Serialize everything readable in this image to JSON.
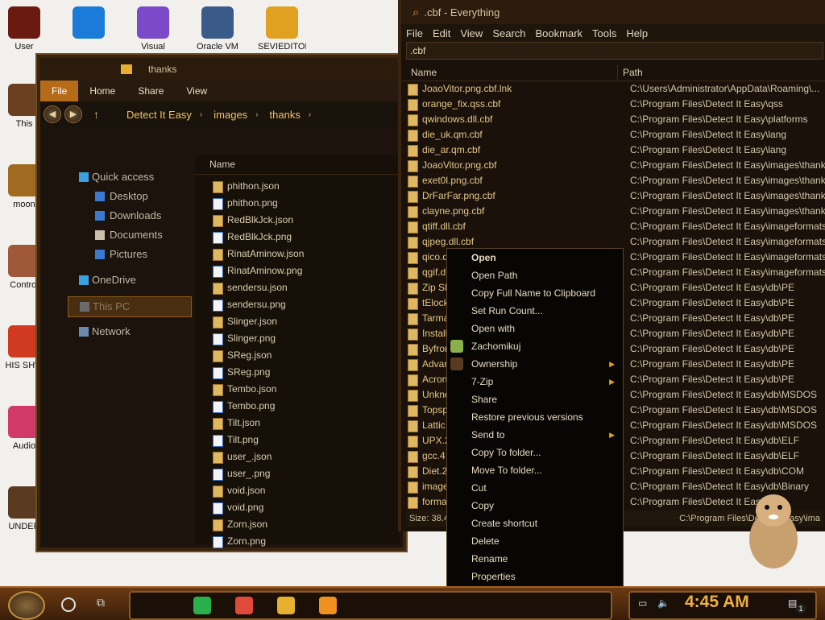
{
  "desktop": {
    "icons": [
      {
        "label": "User",
        "color": "#6a1a10"
      },
      {
        "label": "",
        "color": "#1a7cd8"
      },
      {
        "label": "Visual",
        "color": "#7a4ac8"
      },
      {
        "label": "Oracle VM",
        "color": "#3a5a8a"
      },
      {
        "label": "SEVIEDITOR",
        "color": "#e0a020"
      },
      {
        "label": "This",
        "color": "#6a4020"
      },
      {
        "label": "moon",
        "color": "#a06a20"
      },
      {
        "label": "Control",
        "color": "#a0583a"
      },
      {
        "label": "HIS SHW",
        "color": "#d03a20"
      },
      {
        "label": "Audio",
        "color": "#d03a6a"
      },
      {
        "label": "UNDER",
        "color": "#5a3a20"
      }
    ]
  },
  "explorer": {
    "title": "thanks",
    "ribbon_tabs": [
      "File",
      "Home",
      "Share",
      "View"
    ],
    "breadcrumb": [
      "Detect It Easy",
      "images",
      "thanks"
    ],
    "nav": [
      {
        "label": "Quick access",
        "color": "#3aa0e0"
      },
      {
        "label": "Desktop",
        "color": "#3a7ad0"
      },
      {
        "label": "Downloads",
        "color": "#3a7ad0"
      },
      {
        "label": "Documents",
        "color": "#c8c0a8"
      },
      {
        "label": "Pictures",
        "color": "#3a7ad0"
      },
      {
        "label": "OneDrive",
        "color": "#3aa0e0"
      },
      {
        "label": "This PC",
        "color": "#6a6a6a"
      },
      {
        "label": "Network",
        "color": "#6a8ab0"
      }
    ],
    "column_name": "Name",
    "files": [
      {
        "name": "phithon.json",
        "type": "json"
      },
      {
        "name": "phithon.png",
        "type": "png"
      },
      {
        "name": "RedBlkJck.json",
        "type": "json"
      },
      {
        "name": "RedBlkJck.png",
        "type": "png"
      },
      {
        "name": "RinatAminow.json",
        "type": "json"
      },
      {
        "name": "RinatAminow.png",
        "type": "png"
      },
      {
        "name": "sendersu.json",
        "type": "json"
      },
      {
        "name": "sendersu.png",
        "type": "png"
      },
      {
        "name": "Slinger.json",
        "type": "json"
      },
      {
        "name": "Slinger.png",
        "type": "png"
      },
      {
        "name": "SReg.json",
        "type": "json"
      },
      {
        "name": "SReg.png",
        "type": "png"
      },
      {
        "name": "Tembo.json",
        "type": "json"
      },
      {
        "name": "Tembo.png",
        "type": "png"
      },
      {
        "name": "Tilt.json",
        "type": "json"
      },
      {
        "name": "Tilt.png",
        "type": "png"
      },
      {
        "name": "user_.json",
        "type": "json"
      },
      {
        "name": "user_.png",
        "type": "png"
      },
      {
        "name": "void.json",
        "type": "json"
      },
      {
        "name": "void.png",
        "type": "png"
      },
      {
        "name": "Zorn.json",
        "type": "json"
      },
      {
        "name": "Zorn.png",
        "type": "png"
      }
    ]
  },
  "everything": {
    "title": ".cbf - Everything",
    "menus": [
      "File",
      "Edit",
      "View",
      "Search",
      "Bookmark",
      "Tools",
      "Help"
    ],
    "search": ".cbf",
    "col_name": "Name",
    "col_path": "Path",
    "rows": [
      {
        "name": "JoaoVitor.png.cbf.lnk",
        "path": "C:\\Users\\Administrator\\AppData\\Roaming\\..."
      },
      {
        "name": "orange_fix.qss.cbf",
        "path": "C:\\Program Files\\Detect It Easy\\qss"
      },
      {
        "name": "qwindows.dll.cbf",
        "path": "C:\\Program Files\\Detect It Easy\\platforms"
      },
      {
        "name": "die_uk.qm.cbf",
        "path": "C:\\Program Files\\Detect It Easy\\lang"
      },
      {
        "name": "die_ar.qm.cbf",
        "path": "C:\\Program Files\\Detect It Easy\\lang"
      },
      {
        "name": "JoaoVitor.png.cbf",
        "path": "C:\\Program Files\\Detect It Easy\\images\\thanks"
      },
      {
        "name": "exet0l.png.cbf",
        "path": "C:\\Program Files\\Detect It Easy\\images\\thanks"
      },
      {
        "name": "DrFarFar.png.cbf",
        "path": "C:\\Program Files\\Detect It Easy\\images\\thanks"
      },
      {
        "name": "clayne.png.cbf",
        "path": "C:\\Program Files\\Detect It Easy\\images\\thanks"
      },
      {
        "name": "qtiff.dll.cbf",
        "path": "C:\\Program Files\\Detect It Easy\\imageformats"
      },
      {
        "name": "qjpeg.dll.cbf",
        "path": "C:\\Program Files\\Detect It Easy\\imageformats"
      },
      {
        "name": "qico.d",
        "path": "C:\\Program Files\\Detect It Easy\\imageformats"
      },
      {
        "name": "qgif.d",
        "path": "C:\\Program Files\\Detect It Easy\\imageformats"
      },
      {
        "name": "Zip SF",
        "path": "C:\\Program Files\\Detect It Easy\\db\\PE"
      },
      {
        "name": "tElock",
        "path": "C:\\Program Files\\Detect It Easy\\db\\PE"
      },
      {
        "name": "Tarma",
        "path": "C:\\Program Files\\Detect It Easy\\db\\PE"
      },
      {
        "name": "Install",
        "path": "C:\\Program Files\\Detect It Easy\\db\\PE"
      },
      {
        "name": "Byfron",
        "path": "C:\\Program Files\\Detect It Easy\\db\\PE"
      },
      {
        "name": "Advan",
        "path": "C:\\Program Files\\Detect It Easy\\db\\PE"
      },
      {
        "name": "Acron",
        "path": "C:\\Program Files\\Detect It Easy\\db\\PE"
      },
      {
        "name": "Unkno",
        "path": "C:\\Program Files\\Detect It Easy\\db\\MSDOS"
      },
      {
        "name": "Topsp",
        "path": "C:\\Program Files\\Detect It Easy\\db\\MSDOS"
      },
      {
        "name": "Lattic",
        "path": "C:\\Program Files\\Detect It Easy\\db\\MSDOS"
      },
      {
        "name": "UPX.2",
        "path": "C:\\Program Files\\Detect It Easy\\db\\ELF"
      },
      {
        "name": "gcc.4",
        "path": "C:\\Program Files\\Detect It Easy\\db\\ELF"
      },
      {
        "name": "Diet.2",
        "path": "C:\\Program Files\\Detect It Easy\\db\\COM"
      },
      {
        "name": "image",
        "path": "C:\\Program Files\\Detect It Easy\\db\\Binary"
      },
      {
        "name": "forma",
        "path": "C:\\Program Files\\Detect It Easy\\db\\..."
      }
    ],
    "status_left": "Size: 38.4",
    "status_right": "C:\\Program Files\\Detect It Easy\\ima"
  },
  "context_menu": [
    {
      "label": "Open",
      "bold": true
    },
    {
      "label": "Open Path"
    },
    {
      "label": "Copy Full Name to Clipboard"
    },
    {
      "label": "Set Run Count..."
    },
    {
      "label": "Open with"
    },
    {
      "label": "Zachomikuj",
      "icon": "#8ab04a"
    },
    {
      "label": "Ownership",
      "sub": true,
      "icon": "#5a3a20"
    },
    {
      "label": "7-Zip",
      "sub": true
    },
    {
      "label": "Share"
    },
    {
      "label": "Restore previous versions"
    },
    {
      "label": "Send to",
      "sub": true
    },
    {
      "label": "Copy To folder..."
    },
    {
      "label": "Move To folder..."
    },
    {
      "label": "Cut"
    },
    {
      "label": "Copy"
    },
    {
      "label": "Create shortcut"
    },
    {
      "label": "Delete"
    },
    {
      "label": "Rename"
    },
    {
      "label": "Properties"
    }
  ],
  "taskbar": {
    "apps": [
      {
        "name": "chat-icon",
        "color": "#2ab04a"
      },
      {
        "name": "chrome-icon",
        "color": "#e04a3a"
      },
      {
        "name": "folder-icon",
        "color": "#e8b030"
      },
      {
        "name": "everything-icon",
        "color": "#f09020"
      }
    ],
    "clock": "4:45 AM",
    "notification_count": "1"
  }
}
